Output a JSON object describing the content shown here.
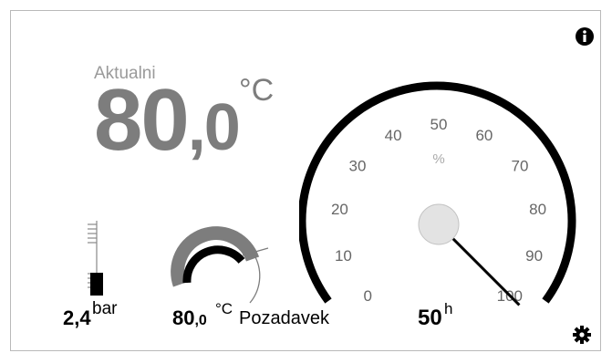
{
  "temperature": {
    "label": "Aktualni",
    "whole": "80",
    "decimal": ",0",
    "unit": "°C"
  },
  "pressure": {
    "value_whole": "2,4",
    "unit": "bar"
  },
  "requested": {
    "value_whole": "80",
    "value_decimal": ",0",
    "unit": "°C",
    "label": "Pozadavek"
  },
  "hours": {
    "value": "50",
    "unit": "h"
  },
  "gauge": {
    "unit": "%",
    "ticks": [
      "0",
      "10",
      "20",
      "30",
      "40",
      "50",
      "60",
      "70",
      "80",
      "90",
      "100"
    ],
    "value_percent": 100
  },
  "icons": {
    "info": "info-icon",
    "settings": "gear-icon"
  },
  "colors": {
    "accent": "#000000",
    "text_muted": "#7d7d7d",
    "needle_hub": "#e0e0e0"
  }
}
